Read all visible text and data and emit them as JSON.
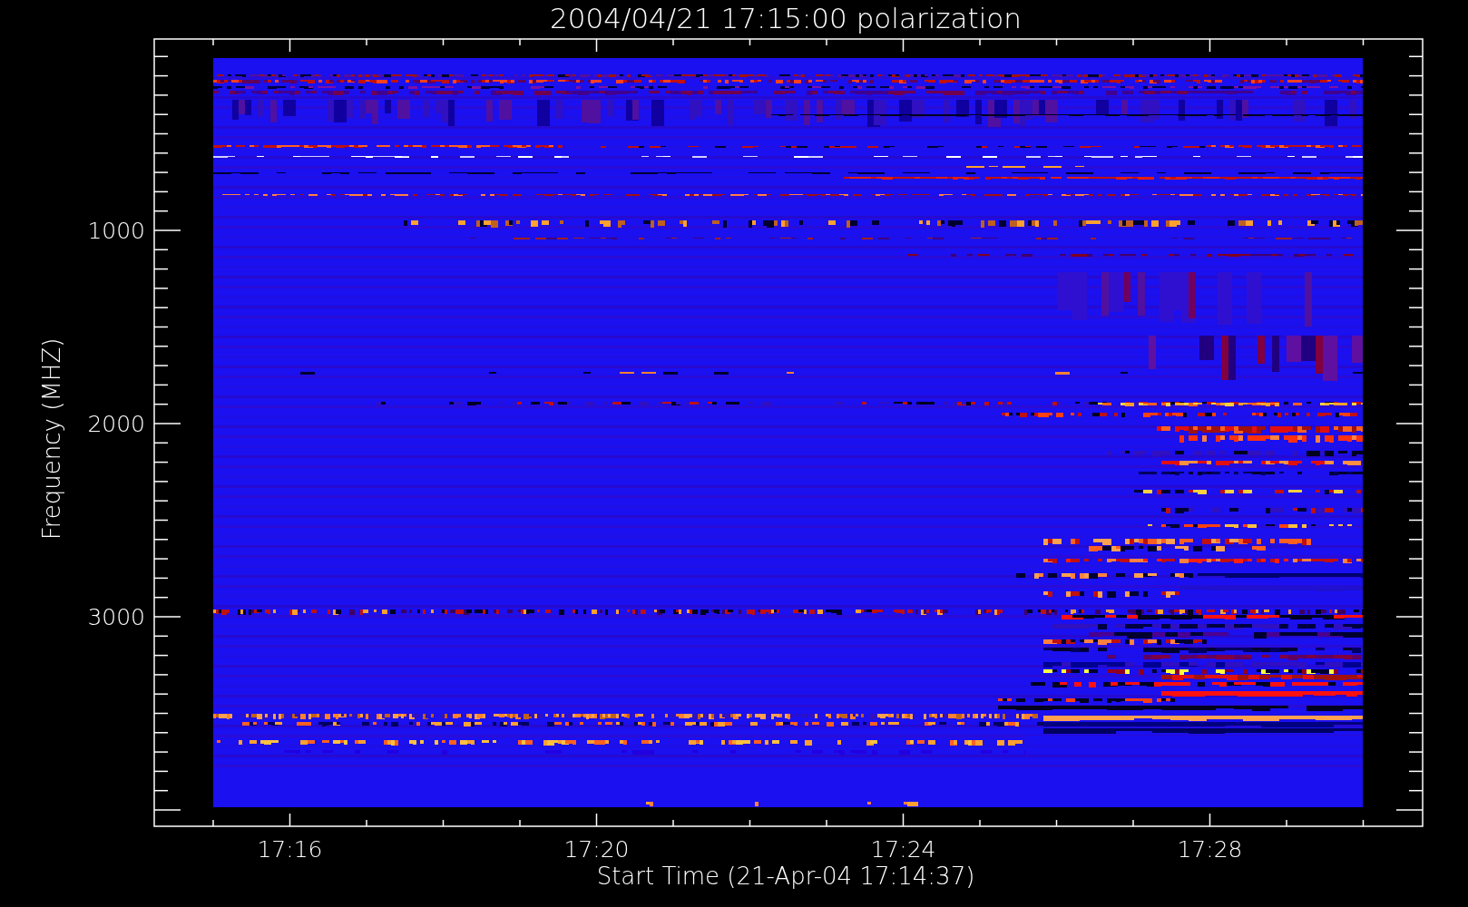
{
  "plot": {
    "title": "2004/04/21 17:15:00 polarization",
    "xlabel": "Start Time (21-Apr-04 17:14:37)",
    "ylabel": "Frequency (MHZ)",
    "x_tick_labels": [
      "17:16",
      "17:20",
      "17:24",
      "17:28"
    ],
    "y_tick_labels": [
      "1000",
      "2000",
      "3000"
    ]
  }
}
